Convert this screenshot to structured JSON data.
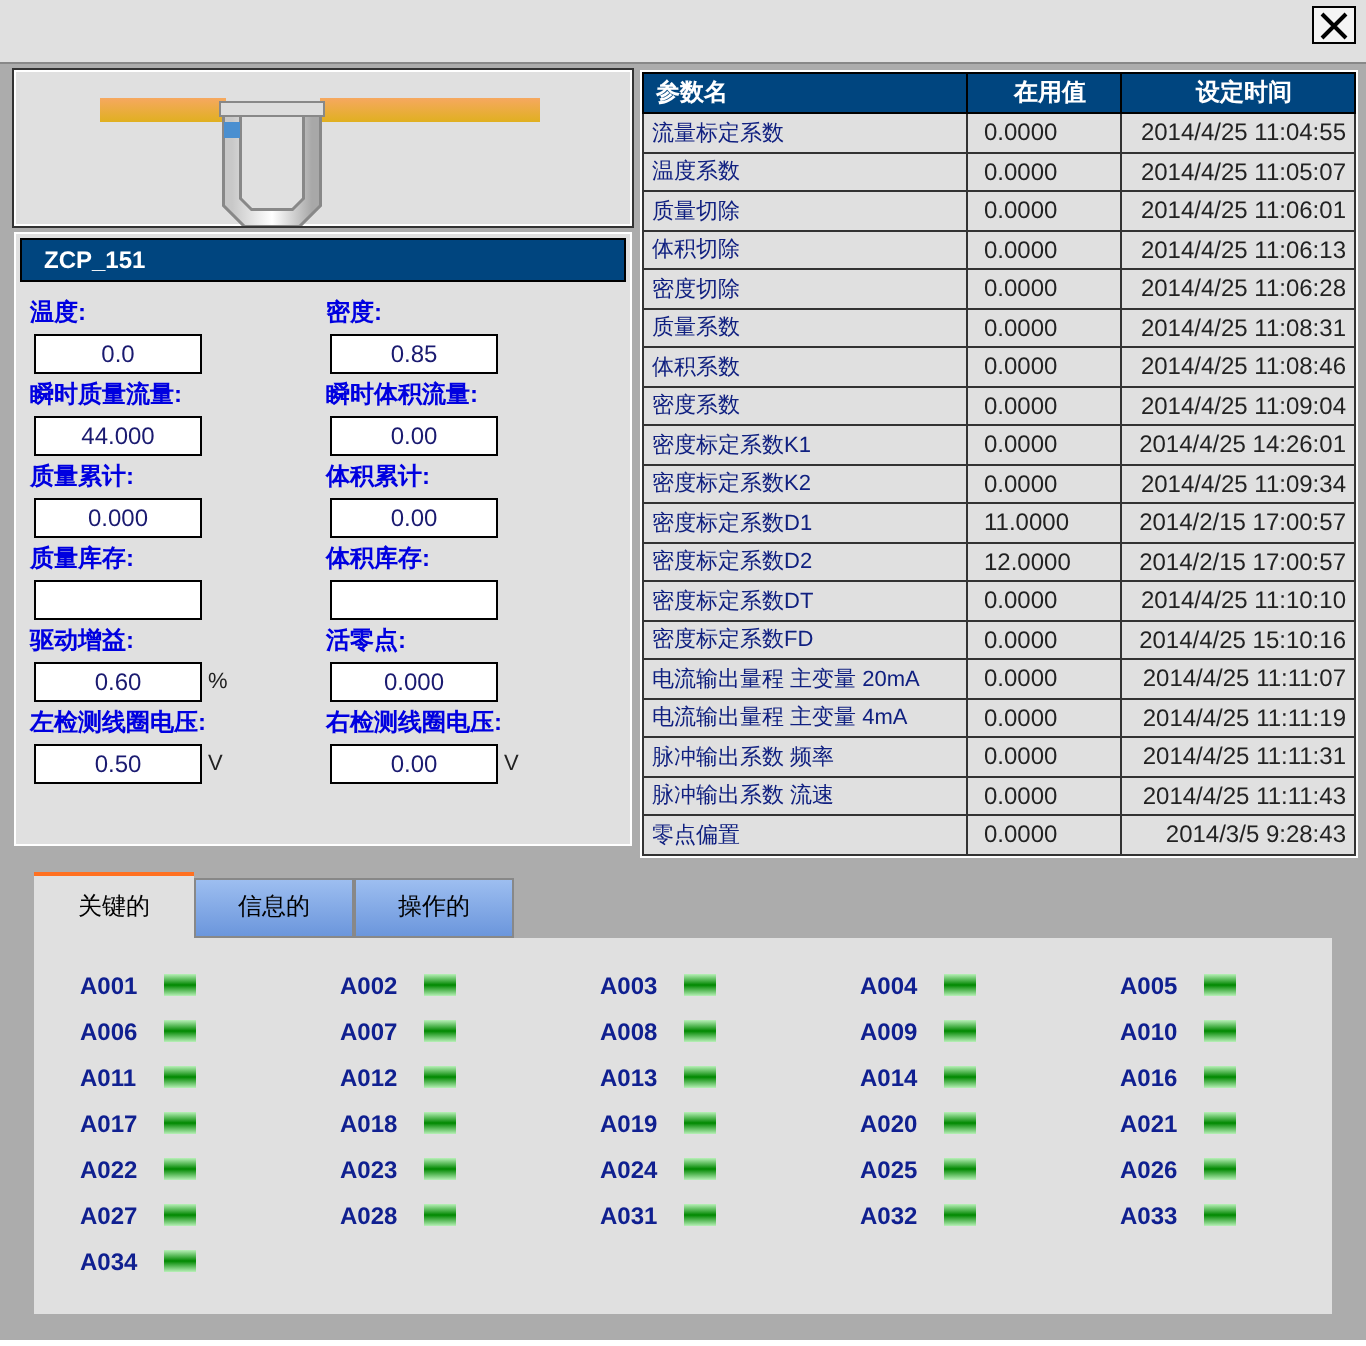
{
  "fields": [
    {
      "label": "温度:",
      "value": "0.0"
    },
    {
      "label": "密度:",
      "value": "0.85"
    },
    {
      "label": "瞬时质量流量:",
      "value": "44.000"
    },
    {
      "label": "瞬时体积流量:",
      "value": "0.00"
    },
    {
      "label": "质量累计:",
      "value": "0.000"
    },
    {
      "label": "体积累计:",
      "value": "0.00"
    },
    {
      "label": "质量库存:"
    },
    {
      "label": "体积库存:"
    },
    {
      "label": "驱动增益:",
      "value": "0.60",
      "unit": "%"
    },
    {
      "label": "活零点:",
      "value": "0.000"
    },
    {
      "label": "左检测线圈电压:",
      "value": "0.50",
      "unit": "V"
    },
    {
      "label": "右检测线圈电压:",
      "value": "0.00",
      "unit": "V"
    }
  ],
  "device": {
    "name": "ZCP_151"
  },
  "table": {
    "columns": [
      "参数名",
      "在用值",
      "设定时间"
    ],
    "rows": [
      [
        "流量标定系数",
        "0.0000",
        "2014/4/25 11:04:55"
      ],
      [
        "温度系数",
        "0.0000",
        "2014/4/25 11:05:07"
      ],
      [
        "质量切除",
        "0.0000",
        "2014/4/25 11:06:01"
      ],
      [
        "体积切除",
        "0.0000",
        "2014/4/25 11:06:13"
      ],
      [
        "密度切除",
        "0.0000",
        "2014/4/25 11:06:28"
      ],
      [
        "质量系数",
        "0.0000",
        "2014/4/25 11:08:31"
      ],
      [
        "体积系数",
        "0.0000",
        "2014/4/25 11:08:46"
      ],
      [
        "密度系数",
        "0.0000",
        "2014/4/25 11:09:04"
      ],
      [
        "密度标定系数K1",
        "0.0000",
        "2014/4/25 14:26:01"
      ],
      [
        "密度标定系数K2",
        "0.0000",
        "2014/4/25 11:09:34"
      ],
      [
        "密度标定系数D1",
        "11.0000",
        "2014/2/15 17:00:57"
      ],
      [
        "密度标定系数D2",
        "12.0000",
        "2014/2/15 17:00:57"
      ],
      [
        "密度标定系数DT",
        "0.0000",
        "2014/4/25 11:10:10"
      ],
      [
        "密度标定系数FD",
        "0.0000",
        "2014/4/25 15:10:16"
      ],
      [
        "电流输出量程 主变量 20mA",
        "0.0000",
        "2014/4/25 11:11:07"
      ],
      [
        "电流输出量程 主变量 4mA",
        "0.0000",
        "2014/4/25 11:11:19"
      ],
      [
        "脉冲输出系数 频率",
        "0.0000",
        "2014/4/25 11:11:31"
      ],
      [
        "脉冲输出系数 流速",
        "0.0000",
        "2014/4/25 11:11:43"
      ],
      [
        "零点偏置",
        "0.0000",
        "2014/3/5 9:28:43"
      ]
    ]
  },
  "tabs": [
    {
      "label": "关键的",
      "selected": true
    },
    {
      "label": "信息的",
      "selected": false
    },
    {
      "label": "操作的",
      "selected": false
    }
  ],
  "alarms": [
    {
      "code": "A001",
      "on": true
    },
    {
      "code": "A002",
      "on": true
    },
    {
      "code": "A003",
      "on": true
    },
    {
      "code": "A004",
      "on": true
    },
    {
      "code": "A005",
      "on": true
    },
    {
      "code": "A006",
      "on": true
    },
    {
      "code": "A007",
      "on": true
    },
    {
      "code": "A008",
      "on": true
    },
    {
      "code": "A009",
      "on": true
    },
    {
      "code": "A010",
      "on": true
    },
    {
      "code": "A011",
      "on": true
    },
    {
      "code": "A012",
      "on": true
    },
    {
      "code": "A013",
      "on": true
    },
    {
      "code": "A014",
      "on": true
    },
    {
      "code": "A016",
      "on": true
    },
    {
      "code": "A017",
      "on": true
    },
    {
      "code": "A018",
      "on": true
    },
    {
      "code": "A019",
      "on": true
    },
    {
      "code": "A020",
      "on": true
    },
    {
      "code": "A021",
      "on": true
    },
    {
      "code": "A022",
      "on": true
    },
    {
      "code": "A023",
      "on": true
    },
    {
      "code": "A024",
      "on": true
    },
    {
      "code": "A025",
      "on": true
    },
    {
      "code": "A026",
      "on": true
    },
    {
      "code": "A027",
      "on": true
    },
    {
      "code": "A028",
      "on": true
    },
    {
      "code": "A031",
      "on": true
    },
    {
      "code": "A032",
      "on": true
    },
    {
      "code": "A033",
      "on": true
    },
    {
      "code": "A034",
      "on": true
    }
  ]
}
